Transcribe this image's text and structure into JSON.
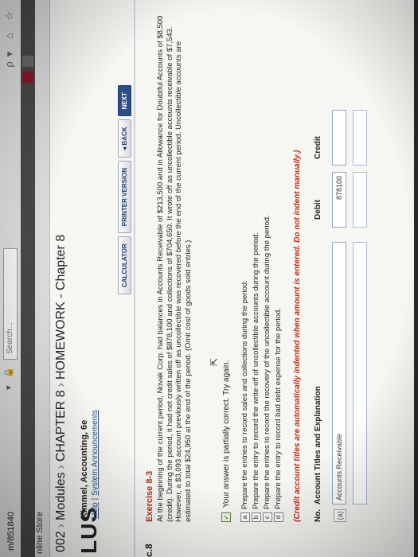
{
  "browser": {
    "url_fragment": "m/851840",
    "search_placeholder": "Search...",
    "toolbar_glyphs": "▾ 🔒 ↻",
    "right_glyphs": "ρ▾ ⌂ ☆",
    "store_tab": "nline Store"
  },
  "breadcrumb": {
    "course": "002",
    "modules": "Modules",
    "chapter": "CHAPTER 8",
    "homework": "HOMEWORK - Chapter 8"
  },
  "book": {
    "logo": "LUS",
    "title": "Kimmel, Accounting, 6e",
    "help": "Help",
    "separator": "|",
    "announcements": "System Announcements"
  },
  "buttons": {
    "calculator": "CALCULATOR",
    "printer": "PRINTER VERSION",
    "back": "◂ BACK",
    "next": "NEXT"
  },
  "side_number": "c.8",
  "exercise": {
    "title": "Exercise 8-3",
    "body": "At the beginning of the current period, Novak Corp. had balances in Accounts Receivable of $213,500 and in Allowance for Doubtful Accounts of $8,500 (credit). During the period, it had net credit sales of $878,100 and collections of $704,650. It wrote off as uncollectible accounts receivable of $7,543. However, a $3,093 account previously written off as uncollectible was recovered before the end of the current period. Uncollectible accounts are estimated to total $24,950 at the end of the period. (Omit cost of goods sold entries.)"
  },
  "status": {
    "check": "✓",
    "message": "Your answer is partially correct.  Try again."
  },
  "tasks": [
    {
      "letter": "a",
      "text": "Prepare the entries to record sales and collections during the period."
    },
    {
      "letter": "b",
      "text": "Prepare the entry to record the write-off of uncollectible accounts during the period."
    },
    {
      "letter": "c",
      "text": "Prepare the entries to record the recovery of the uncollectible account during the period."
    },
    {
      "letter": "d",
      "text": "Prepare the entry to record bad debt expense for the period."
    }
  ],
  "note": "(Credit account titles are automatically indented when amount is entered. Do not indent manually.)",
  "table": {
    "col_no": "No.",
    "col_title": "Account Titles and Explanation",
    "col_debit": "Debit",
    "col_credit": "Credit",
    "rows": [
      {
        "letter": "(a)",
        "account": "Accounts Receivable",
        "debit": "878100",
        "credit": ""
      },
      {
        "letter": "",
        "account": "",
        "debit": "",
        "credit": ""
      }
    ]
  },
  "cursor_glyph": "⇱"
}
